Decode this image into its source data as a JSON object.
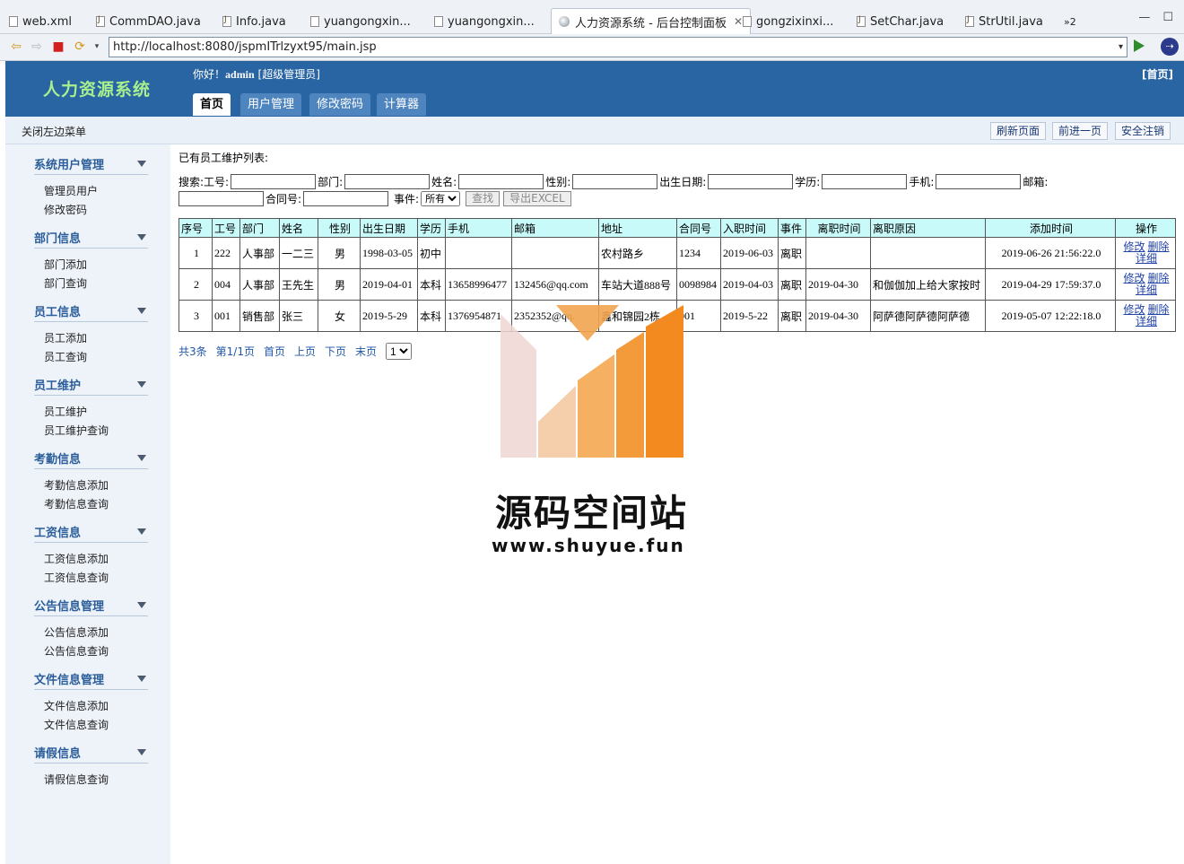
{
  "editor_tabs": [
    {
      "label": "web.xml",
      "icon": "xml-file-icon"
    },
    {
      "label": "CommDAO.java",
      "icon": "java-file-icon"
    },
    {
      "label": "Info.java",
      "icon": "java-file-icon"
    },
    {
      "label": "yuangongxin...",
      "icon": "jsp-file-icon"
    },
    {
      "label": "yuangongxin...",
      "icon": "jsp-file-icon"
    },
    {
      "label": "人力资源系统 - 后台控制面板",
      "icon": "globe-icon",
      "active": true
    },
    {
      "label": "gongzixinxi...",
      "icon": "jsp-file-icon"
    },
    {
      "label": "SetChar.java",
      "icon": "java-file-icon"
    },
    {
      "label": "StrUtil.java",
      "icon": "java-file-icon"
    }
  ],
  "overflow_tabs": "»2",
  "browser": {
    "url": "http://localhost:8080/jspmITrlzyxt95/main.jsp"
  },
  "header": {
    "logo": "人力资源系统",
    "greeting": "你好！",
    "username": "admin",
    "role": "[超级管理员]",
    "home_link": "[首页]",
    "tabs": [
      "首页",
      "用户管理",
      "修改密码",
      "计算器"
    ]
  },
  "subbar": {
    "close_menu": "关闭左边菜单",
    "refresh": "刷新页面",
    "forward": "前进一页",
    "logout": "安全注销"
  },
  "menu": [
    {
      "title": "系统用户管理",
      "items": [
        "管理员用户",
        "修改密码"
      ]
    },
    {
      "title": "部门信息",
      "items": [
        "部门添加",
        "部门查询"
      ]
    },
    {
      "title": "员工信息",
      "items": [
        "员工添加",
        "员工查询"
      ]
    },
    {
      "title": "员工维护",
      "items": [
        "员工维护",
        "员工维护查询"
      ]
    },
    {
      "title": "考勤信息",
      "items": [
        "考勤信息添加",
        "考勤信息查询"
      ]
    },
    {
      "title": "工资信息",
      "items": [
        "工资信息添加",
        "工资信息查询"
      ]
    },
    {
      "title": "公告信息管理",
      "items": [
        "公告信息添加",
        "公告信息查询"
      ]
    },
    {
      "title": "文件信息管理",
      "items": [
        "文件信息添加",
        "文件信息查询"
      ]
    },
    {
      "title": "请假信息",
      "items": [
        "请假信息查询"
      ]
    }
  ],
  "main": {
    "list_title": "已有员工维护列表:",
    "search": {
      "prefix": "搜索:",
      "labels": {
        "gonghao": "工号:",
        "bumen": "部门:",
        "xingming": "姓名:",
        "xingbie": "性别:",
        "birth": "出生日期:",
        "xueli": "学历:",
        "phone": "手机:",
        "email": "邮箱:",
        "contract": "合同号:",
        "event": "事件:"
      },
      "event_selected": "所有",
      "search_btn": "查找",
      "export_btn": "导出EXCEL"
    },
    "table": {
      "headers": [
        "序号",
        "工号",
        "部门",
        "姓名",
        "性别",
        "出生日期",
        "学历",
        "手机",
        "邮箱",
        "地址",
        "合同号",
        "入职时间",
        "事件",
        "离职时间",
        "离职原因",
        "添加时间",
        "操作"
      ],
      "rows": [
        [
          "1",
          "222",
          "人事部",
          "一二三",
          "男",
          "1998-03-05",
          "初中",
          "",
          "",
          "农村路乡",
          "1234",
          "2019-06-03",
          "离职",
          "",
          "",
          "2019-06-26 21:56:22.0"
        ],
        [
          "2",
          "004",
          "人事部",
          "王先生",
          "男",
          "2019-04-01",
          "本科",
          "13658996477",
          "132456@qq.com",
          "车站大道888号",
          "0098984",
          "2019-04-03",
          "离职",
          "2019-04-30",
          "和伽伽加上给大家按时",
          "2019-04-29 17:59:37.0"
        ],
        [
          "3",
          "001",
          "销售部",
          "张三",
          "女",
          "2019-5-29",
          "本科",
          "1376954871",
          "2352352@qq.",
          "鑫和锦园2栋",
          "001",
          "2019-5-22",
          "离职",
          "2019-04-30",
          "阿萨德阿萨德阿萨德",
          "2019-05-07 12:22:18.0"
        ]
      ],
      "op_labels": {
        "edit": "修改",
        "delete": "删除",
        "detail": "详细"
      }
    },
    "pager": {
      "total": "共3条",
      "page": "第1/1页",
      "first": "首页",
      "prev": "上页",
      "next": "下页",
      "last": "末页",
      "selected": "1"
    }
  },
  "watermark": {
    "title": "源码空间站",
    "url": "www.shuyue.fun"
  },
  "colors": {
    "header_bg": "#2a65a3",
    "logo": "#a8f08e",
    "table_header": "#c8fafa",
    "sidebar_bg": "#eef3fa",
    "wm_orange": "#f38a1f"
  }
}
